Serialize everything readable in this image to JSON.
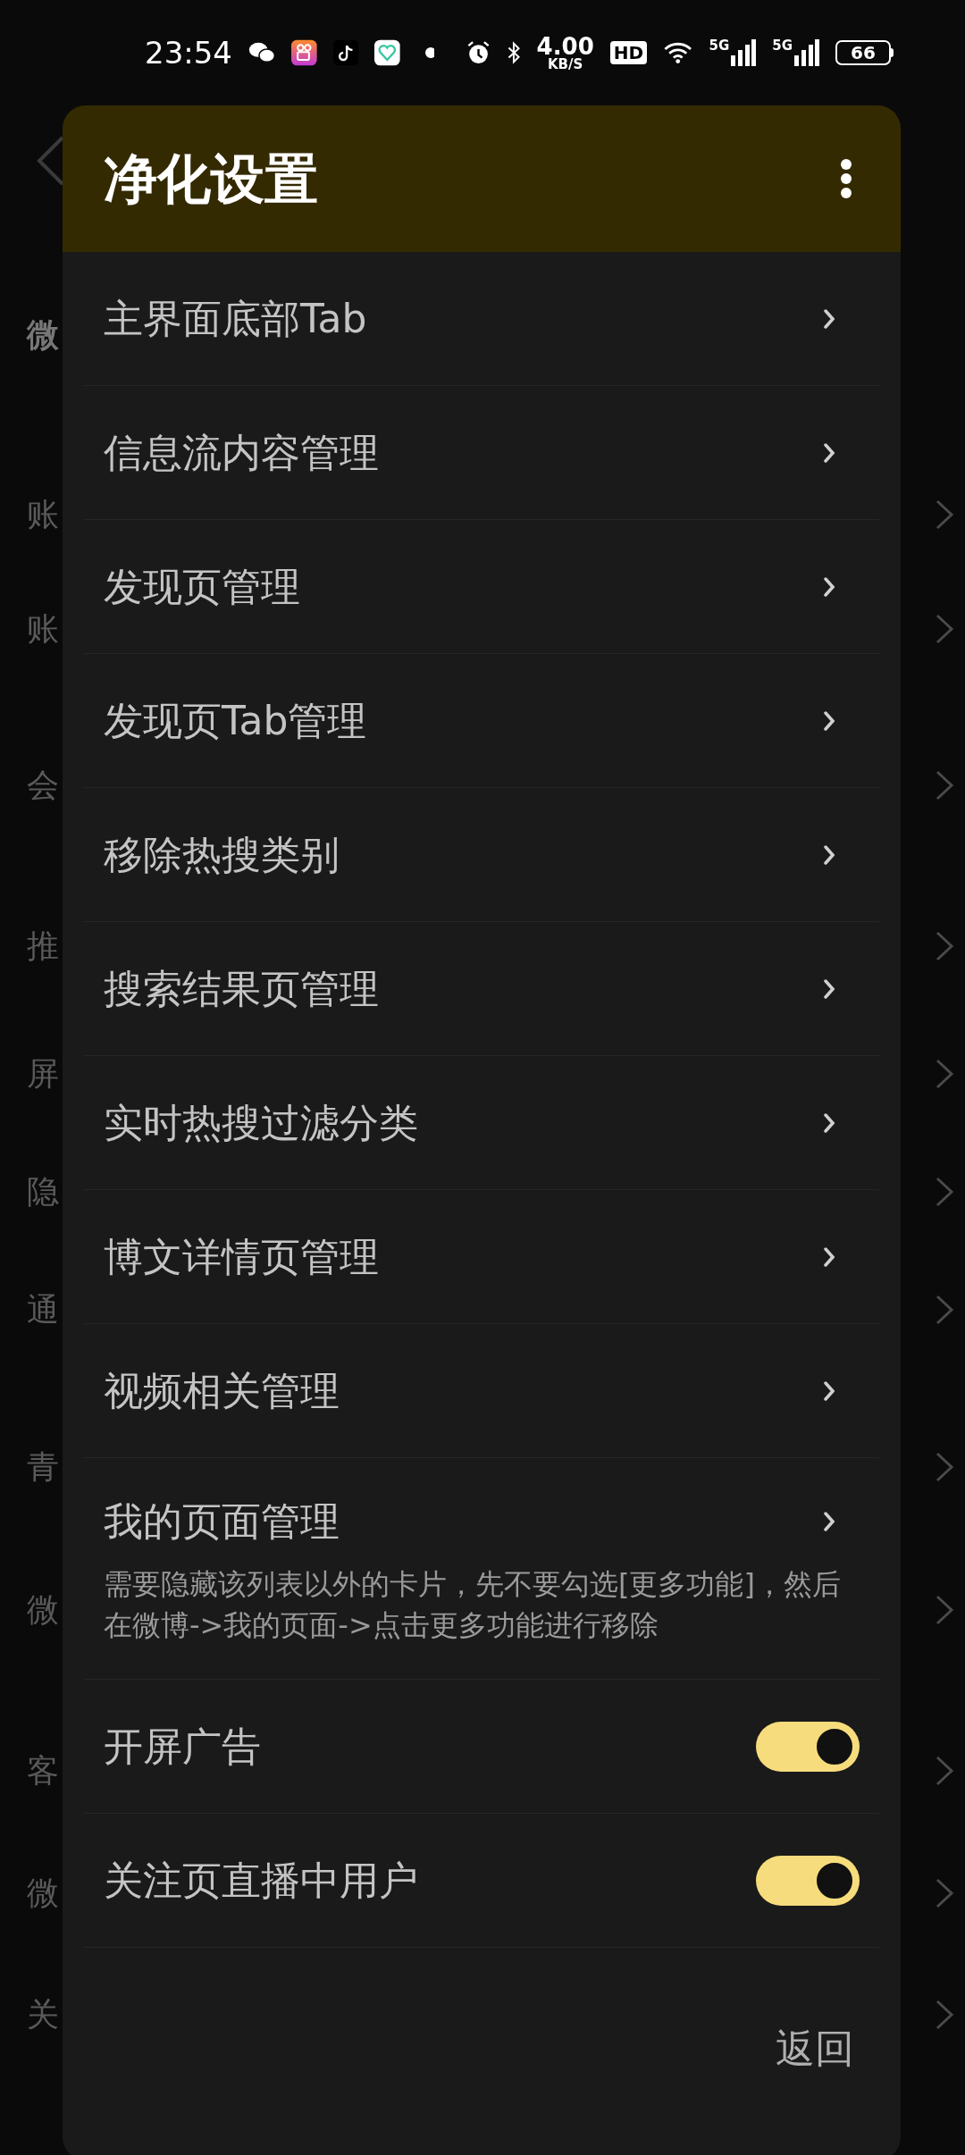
{
  "status_bar": {
    "time": "23:54",
    "speed_value": "4.00",
    "speed_unit": "KB/S",
    "hd": "HD",
    "networks": [
      "5G",
      "5G"
    ],
    "battery": "66"
  },
  "background": {
    "rows": [
      {
        "label": "微",
        "chevron": false
      },
      {
        "label": "账",
        "chevron": true
      },
      {
        "label": "账",
        "chevron": true
      },
      {
        "label": "会",
        "chevron": true
      },
      {
        "label": "推",
        "chevron": true
      },
      {
        "label": "屏",
        "chevron": true
      },
      {
        "label": "隐",
        "chevron": true
      },
      {
        "label": "通",
        "chevron": true
      },
      {
        "label": "青",
        "chevron": true
      },
      {
        "label": "微",
        "chevron": true
      },
      {
        "label": "客",
        "chevron": true
      },
      {
        "label": "微",
        "chevron": true
      },
      {
        "label": "关",
        "chevron": true
      }
    ]
  },
  "dialog": {
    "title": "净化设置",
    "items": [
      {
        "kind": "nav",
        "label": "主界面底部Tab"
      },
      {
        "kind": "nav",
        "label": "信息流内容管理"
      },
      {
        "kind": "nav",
        "label": "发现页管理"
      },
      {
        "kind": "nav",
        "label": "发现页Tab管理"
      },
      {
        "kind": "nav",
        "label": "移除热搜类别"
      },
      {
        "kind": "nav",
        "label": "搜索结果页管理"
      },
      {
        "kind": "nav",
        "label": "实时热搜过滤分类"
      },
      {
        "kind": "nav",
        "label": "博文详情页管理"
      },
      {
        "kind": "nav",
        "label": "视频相关管理"
      },
      {
        "kind": "nav",
        "label": "我的页面管理",
        "description": "需要隐藏该列表以外的卡片，先不要勾选[更多功能]，然后在微博->我的页面->点击更多功能进行移除"
      },
      {
        "kind": "toggle",
        "label": "开屏广告",
        "on": true
      },
      {
        "kind": "toggle",
        "label": "关注页直播中用户",
        "on": true
      }
    ],
    "footer_button": "返回"
  }
}
